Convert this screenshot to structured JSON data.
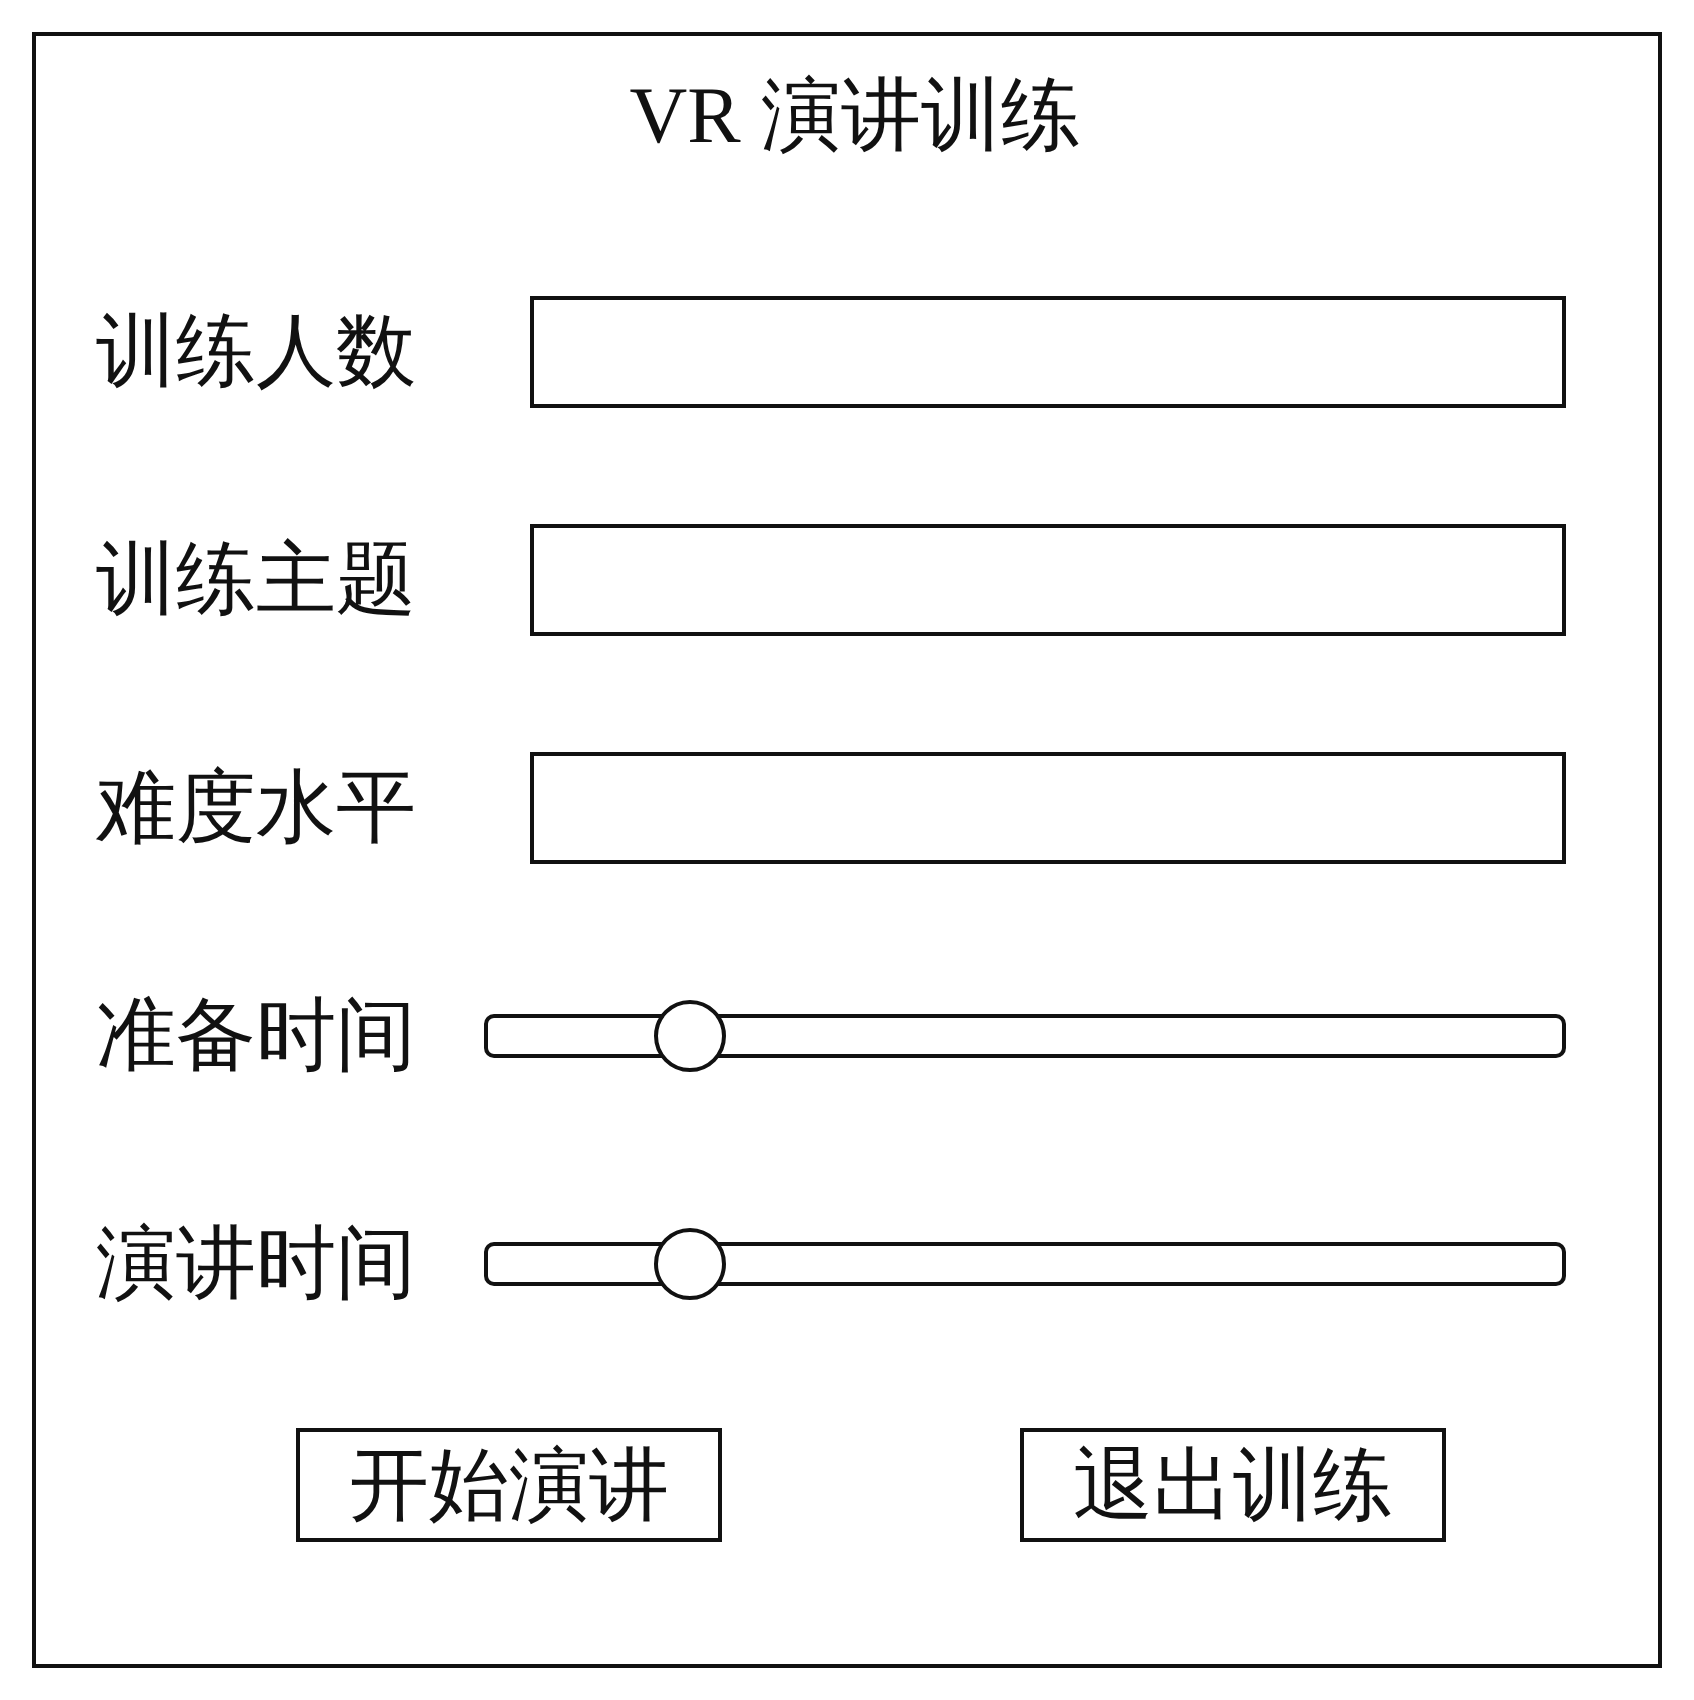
{
  "window": {
    "title": "VR 演讲训练"
  },
  "fields": [
    {
      "kind": "text",
      "label": "训练人数"
    },
    {
      "kind": "text",
      "label": "训练主题"
    },
    {
      "kind": "text",
      "label": "难度水平"
    },
    {
      "kind": "slider",
      "label": "准备时间",
      "level": 0.19
    },
    {
      "kind": "slider",
      "label": "演讲时间",
      "level": 0.19
    }
  ],
  "buttons": [
    {
      "label": "开始演讲"
    },
    {
      "label": "退出训练"
    }
  ]
}
